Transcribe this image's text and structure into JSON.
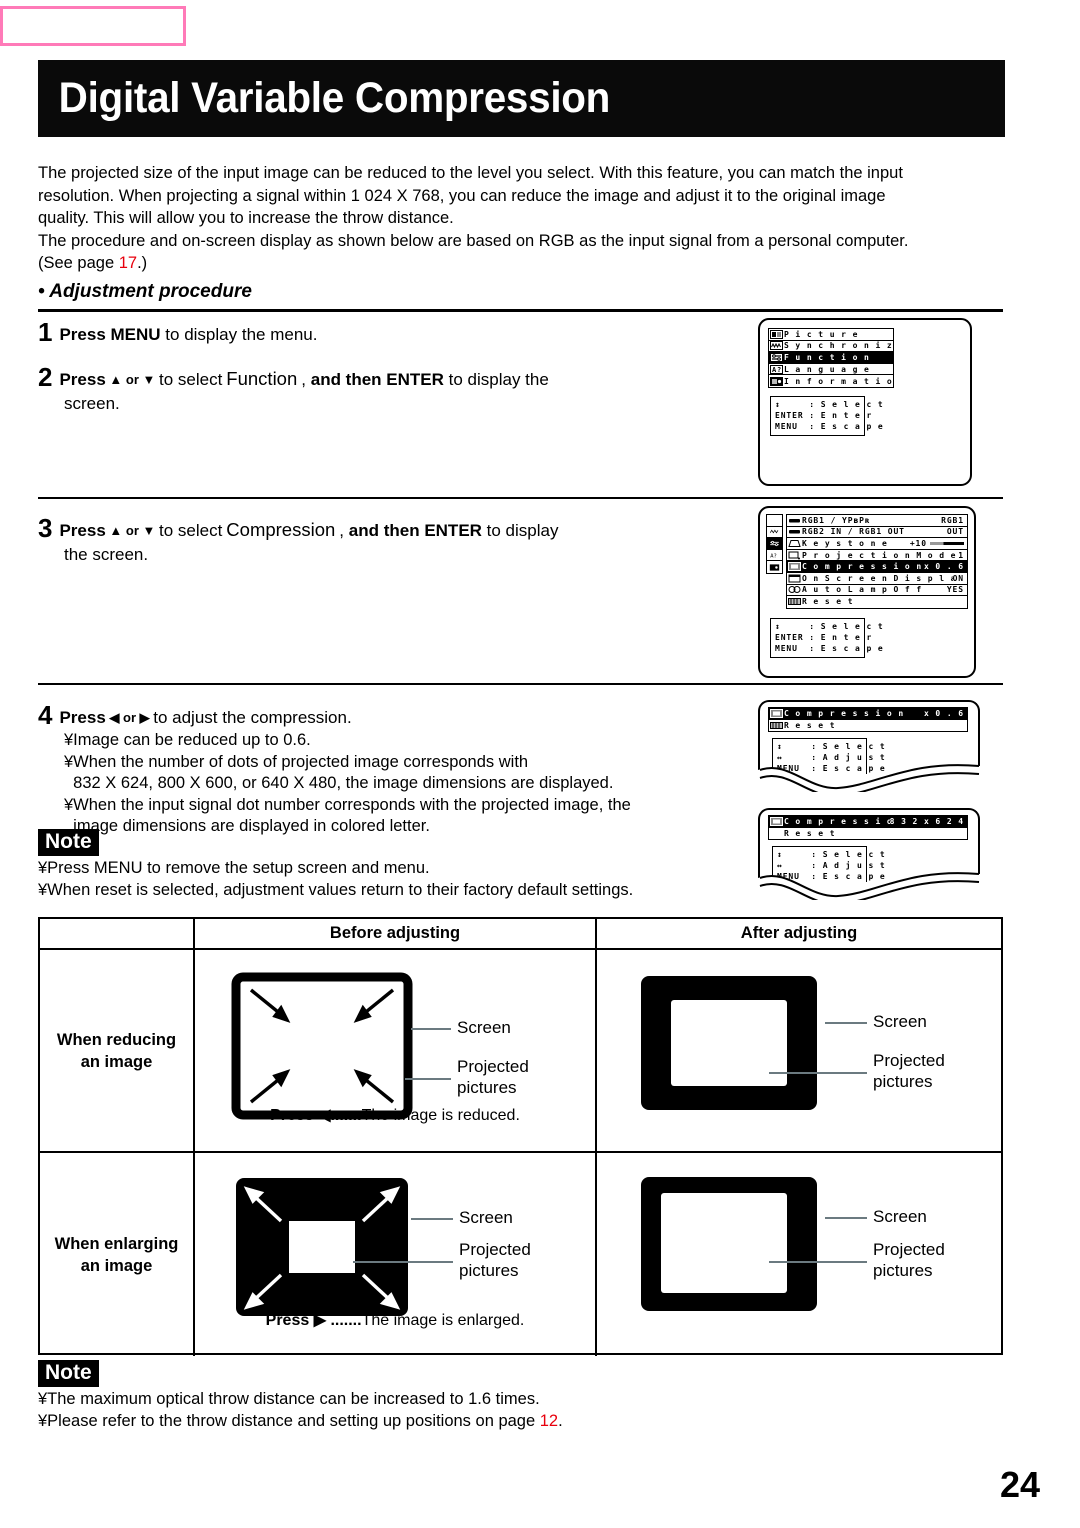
{
  "page": {
    "title": "Digital Variable Compression",
    "page_number": "24"
  },
  "intro": {
    "line1": "The projected size of the input image can be reduced to the level you select. With this feature, you can match the input",
    "line2": "resolution. When projecting a signal within 1 024 X 768, you can reduce the image and adjust it to the original image",
    "line3": "quality. This will allow you to increase the throw distance.",
    "line4": "The procedure and on-screen display as shown below are based on RGB as the input signal from a personal computer.",
    "line5_pre": "(See page ",
    "line5_ref": "17",
    "line5_post": ".)"
  },
  "section": {
    "heading": "• Adjustment procedure"
  },
  "steps": {
    "s1": {
      "num": "1",
      "bold1": "Press MENU",
      "rest": " to display the menu."
    },
    "s2": {
      "num": "2",
      "bold1": "Press",
      "arrows": " ▲ or ▼ ",
      "mid": "to select",
      "boxed": "Function",
      "comma": ",",
      "bold2": "and then ENTER",
      "rest": " to display the",
      "cont": "screen."
    },
    "s3": {
      "num": "3",
      "bold1": "Press",
      "arrows": " ▲ or ▼ ",
      "mid": "to select",
      "boxed": "Compression",
      "comma": ",",
      "bold2": "and then ENTER",
      "rest": " to display",
      "cont": "the screen."
    },
    "s4": {
      "num": "4",
      "bold1": "Press",
      "arrows": " ◀ or ▶ ",
      "rest": "to adjust the compression.",
      "bullets": [
        "¥Image can be reduced up to 0.6.",
        "¥When the number of dots of projected image corresponds with",
        "  832 X 624, 800 X 600, or 640 X 480, the image dimensions are displayed.",
        "¥When the input signal dot number corresponds with the projected image, the",
        "  image dimensions are displayed in colored letter."
      ]
    }
  },
  "note1": {
    "badge": "Note",
    "lines": [
      "¥Press MENU to remove the setup screen and menu.",
      "¥When reset is selected, adjustment values return to their factory default settings."
    ]
  },
  "note2": {
    "badge": "Note",
    "line1": "¥The maximum optical throw distance can be increased to 1.6 times.",
    "line2_pre": "¥Please refer to the throw distance and setting up positions on page ",
    "line2_ref": "12",
    "line2_post": "."
  },
  "osd": {
    "main_menu": {
      "items": [
        {
          "icon": "picture-icon",
          "label": "P i c t u r e",
          "value": "",
          "selected": false
        },
        {
          "icon": "sync-icon",
          "label": "S y n c h r o n i z a t i o n",
          "value": "",
          "selected": false
        },
        {
          "icon": "function-icon",
          "label": "F u n c t i o n",
          "value": "",
          "selected": true
        },
        {
          "icon": "language-icon",
          "label": "L a n g u a g e",
          "value": "",
          "selected": false
        },
        {
          "icon": "information-icon",
          "label": "I n f o r m a t i o n",
          "value": "",
          "selected": false
        }
      ],
      "help": [
        "↕     : S e l e c t",
        "ENTER : E n t e r",
        "MENU  : E s c a p e"
      ]
    },
    "function_menu": {
      "items": [
        {
          "icon": "rgb1-icon",
          "label": "RGB1 / YPʙPʀ",
          "value": "RGB1",
          "selected": false
        },
        {
          "icon": "rgb2-icon",
          "label": "RGB2  IN / RGB1  OUT",
          "value": "OUT",
          "selected": false
        },
        {
          "icon": "keystone-icon",
          "label": "K e y s t o n e",
          "value": "+10",
          "selected": false,
          "slider": true
        },
        {
          "icon": "projection-mode-icon",
          "label": "P r o j e c t i o n   M o d e",
          "value": "1",
          "selected": false
        },
        {
          "icon": "compression-icon",
          "label": "C o m p r e s s i o n",
          "value": "x 0 . 6",
          "selected": true
        },
        {
          "icon": "on-screen-display-icon",
          "label": "O n   S c r e e n   D i s p l a y",
          "value": "ON",
          "selected": false
        },
        {
          "icon": "auto-lamp-off-icon",
          "label": "A u t o   L a m p   O f f",
          "value": "YES",
          "selected": false
        },
        {
          "icon": "reset-icon",
          "label": "R e s e t",
          "value": "",
          "selected": false
        }
      ],
      "help": [
        "↕     : S e l e c t",
        "ENTER : E n t e r",
        "MENU  : E s c a p e"
      ]
    },
    "compression_screen_1": {
      "title": "C o m p r e s s i o n",
      "value": "x 0 . 6",
      "reset": "R e s e t",
      "help": [
        "↕     : S e l e c t",
        "↔     : A d j u s t",
        "MENU  : E s c a p e"
      ]
    },
    "compression_screen_2": {
      "title": "C o m p r e s s i o n",
      "value": "8 3 2 x 6 2 4",
      "reset": "R e s e t",
      "help": [
        "↕     : S e l e c t",
        "↔     : A d j u s t",
        "MENU  : E s c a p e"
      ]
    }
  },
  "table": {
    "headers": {
      "corner": "",
      "before": "Before adjusting",
      "after": "After adjusting"
    },
    "rows": [
      {
        "label_line1": "When reducing",
        "label_line2": "an image",
        "before_caption_bold": "Press ◀",
        "before_caption_dots": ".......",
        "before_caption_rest": "The image is reduced.",
        "before_label_screen": "Screen",
        "before_label_projected_l1": "Projected",
        "before_label_projected_l2": "pictures",
        "after_label_screen": "Screen",
        "after_label_projected_l1": "Projected",
        "after_label_projected_l2": "pictures"
      },
      {
        "label_line1": "When enlarging",
        "label_line2": "an image",
        "before_caption_bold": "Press ▶",
        "before_caption_dots": ".......",
        "before_caption_rest": "The image is enlarged.",
        "before_label_screen": "Screen",
        "before_label_projected_l1": "Projected",
        "before_label_projected_l2": "pictures",
        "after_label_screen": "Screen",
        "after_label_projected_l1": "Projected",
        "after_label_projected_l2": "pictures"
      }
    ]
  },
  "colors": {
    "accent_red": "#e8000d",
    "marker_pink": "#ff7ab8",
    "ink": "#000000"
  }
}
